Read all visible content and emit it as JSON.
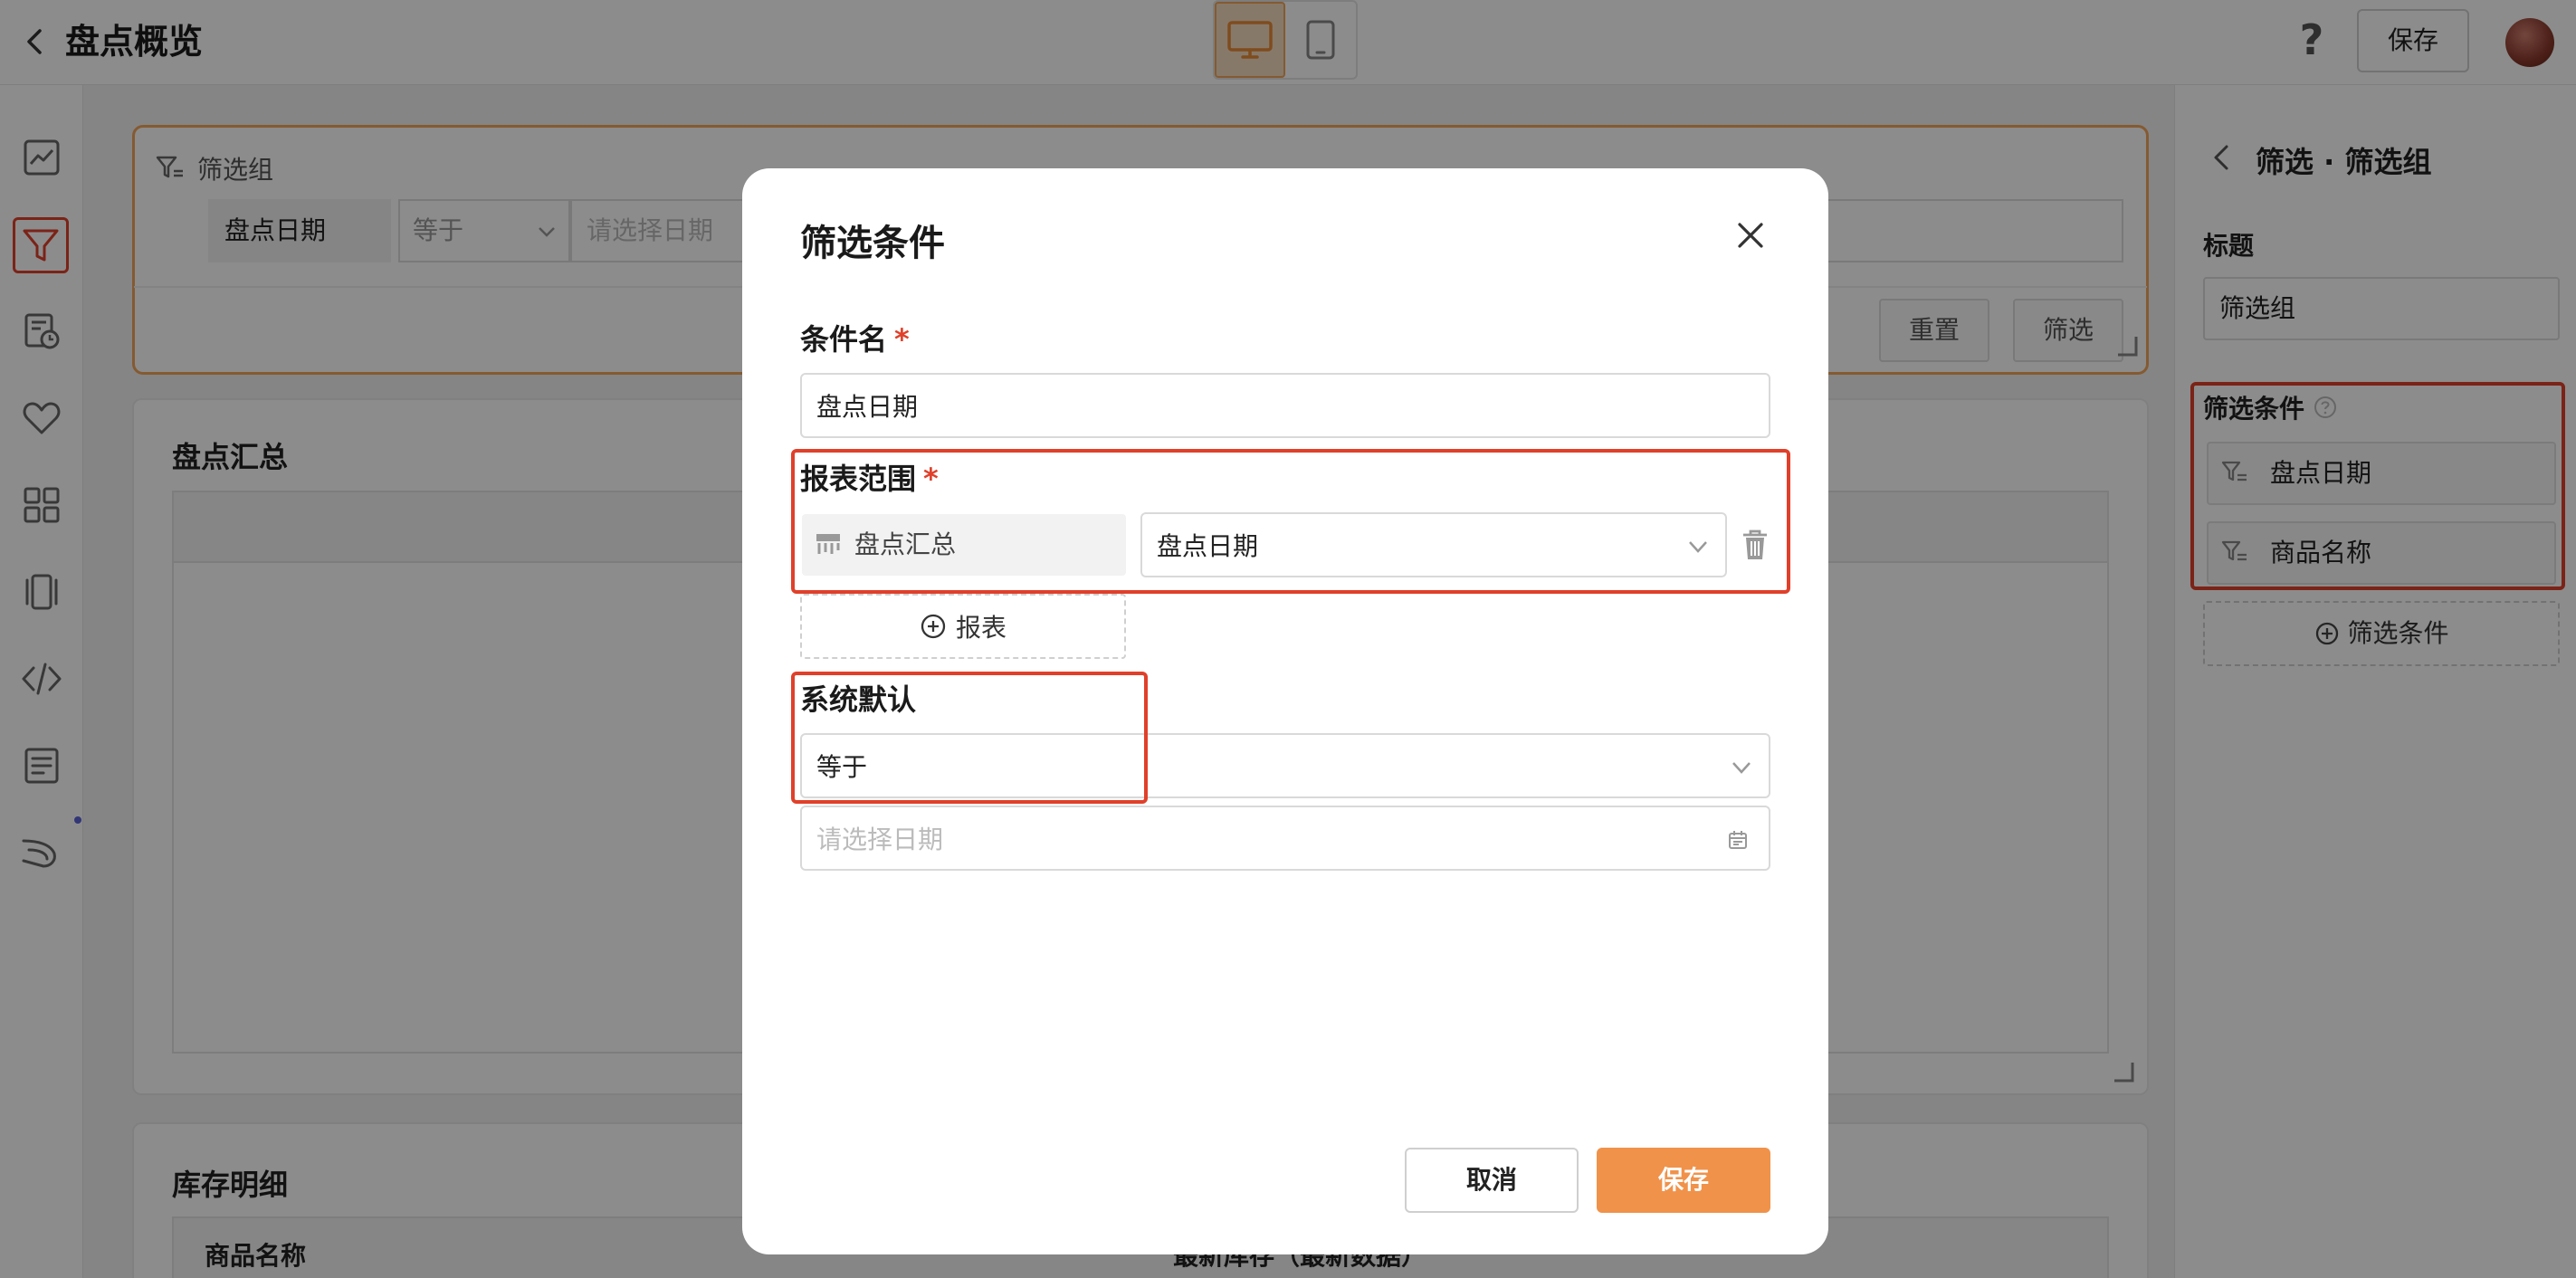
{
  "header": {
    "title": "盘点概览",
    "help_label": "?",
    "save_label": "保存"
  },
  "canvas": {
    "filter_group": {
      "title": "筛选组",
      "field_label": "盘点日期",
      "operator": "等于",
      "date_placeholder": "请选择日期",
      "reset_label": "重置",
      "filter_label": "筛选"
    },
    "summary": {
      "title": "盘点汇总"
    },
    "stock": {
      "title": "库存明细",
      "columns": [
        "商品名称",
        "最新库存（最新数据）"
      ]
    }
  },
  "right_panel": {
    "breadcrumb": "筛选 · 筛选组",
    "title_label": "标题",
    "title_value": "筛选组",
    "conditions_label": "筛选条件",
    "conditions": [
      "盘点日期",
      "商品名称"
    ],
    "add_condition_label": "筛选条件"
  },
  "modal": {
    "title": "筛选条件",
    "name_label": "条件名",
    "name_value": "盘点日期",
    "scope_label": "报表范围",
    "scope_report": "盘点汇总",
    "scope_field": "盘点日期",
    "add_report_label": "报表",
    "default_label": "系统默认",
    "default_operator": "等于",
    "date_placeholder": "请选择日期",
    "required_mark": "*",
    "cancel_label": "取消",
    "save_label": "保存"
  },
  "colors": {
    "accent": "#f0924a",
    "highlight": "#e0402a"
  }
}
